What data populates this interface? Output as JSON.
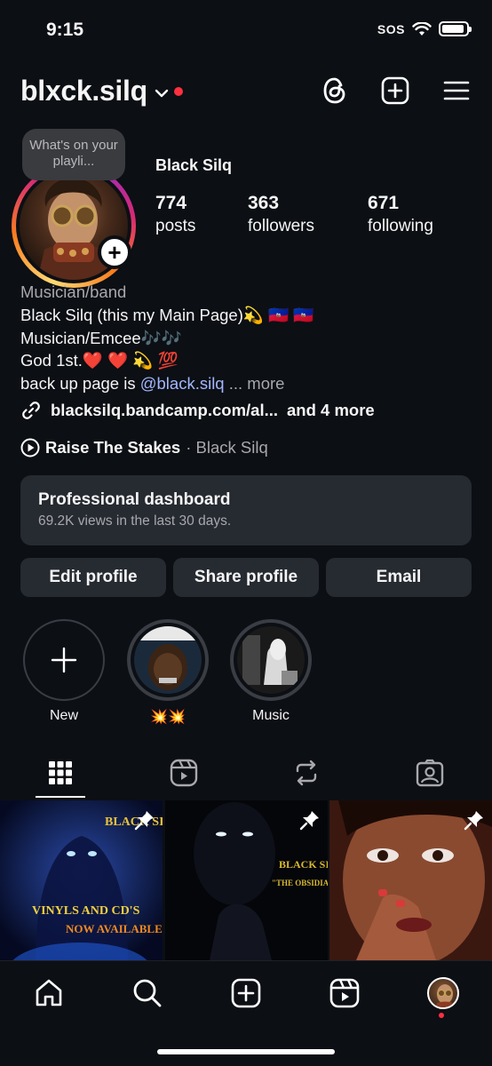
{
  "status_bar": {
    "time": "9:15",
    "sos": "SOS"
  },
  "header": {
    "username": "blxck.silq"
  },
  "profile": {
    "note": "What's on your playli...",
    "display_name": "Black Silq",
    "stats": [
      {
        "value": "774",
        "label": "posts"
      },
      {
        "value": "363",
        "label": "followers"
      },
      {
        "value": "671",
        "label": "following"
      }
    ]
  },
  "bio": {
    "category": "Musician/band",
    "line1": "Black Silq (this my Main Page)💫 🇭🇹 🇭🇹",
    "line2": "Musician/Emcee🎶🎶",
    "line3": "God 1st.❤️ ❤️ 💫 💯",
    "line4_prefix": "back up page is ",
    "mention": "@black.silq",
    "more": "... more",
    "link": "blacksilq.bandcamp.com/al...",
    "link_more": "and 4 more",
    "song": "Raise The Stakes",
    "artist": "· Black Silq"
  },
  "dashboard": {
    "title": "Professional dashboard",
    "subtitle": "69.2K views in the last 30 days."
  },
  "buttons": {
    "edit": "Edit profile",
    "share": "Share profile",
    "email": "Email"
  },
  "highlights": [
    {
      "label": "New"
    },
    {
      "label": "💥💥"
    },
    {
      "label": "Music"
    }
  ],
  "posts": [
    {
      "text1": "BLACK SI",
      "text2": "VINYLS AND CD'S",
      "text3": "NOW AVAILABLE"
    },
    {
      "text1": "BLACK SI",
      "text2": "\"THE OBSIDIAN"
    },
    {
      "text1": ""
    }
  ],
  "colors": {
    "background": "#0c0f14",
    "card": "#262a31",
    "accent_link": "#a3b7ff",
    "notification": "#ff3040"
  }
}
